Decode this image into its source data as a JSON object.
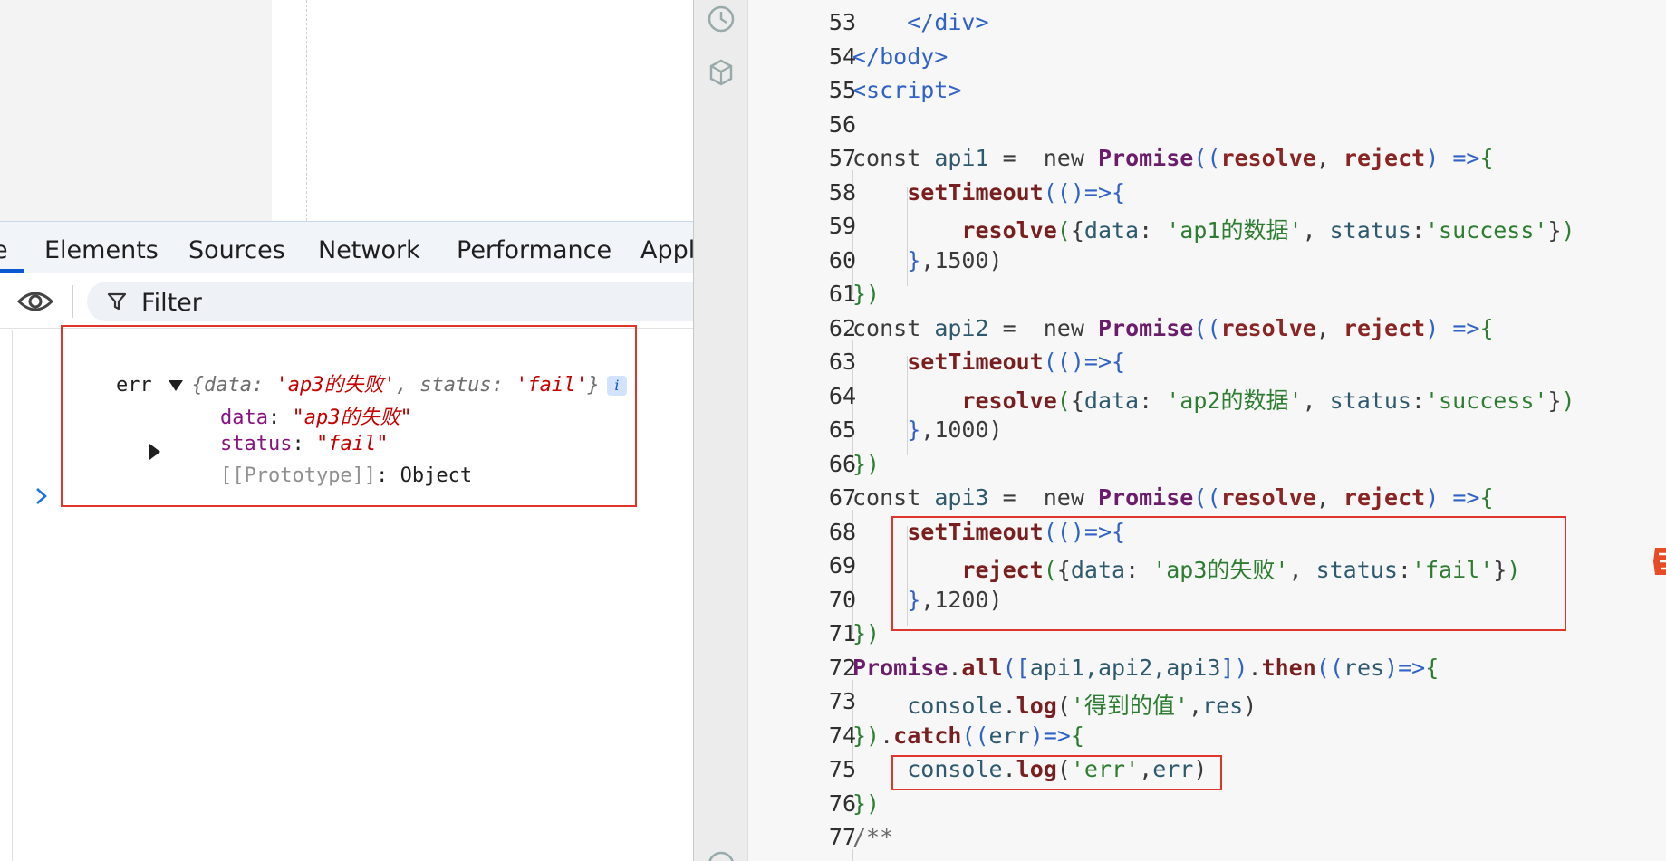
{
  "devtools": {
    "tabs": [
      {
        "label": "e",
        "active": true
      },
      {
        "label": "Elements",
        "active": false
      },
      {
        "label": "Sources",
        "active": false
      },
      {
        "label": "Network",
        "active": false
      },
      {
        "label": "Performance",
        "active": false
      },
      {
        "label": "Appl",
        "active": false
      }
    ],
    "filter_placeholder": "Filter",
    "accent_color": "#0b57d0"
  },
  "console": {
    "entry": {
      "label": "err",
      "summary": {
        "open": "{",
        "k1": "data",
        "v1": "'ap3的失败'",
        "sep": ", ",
        "k2": "status",
        "v2": "'fail'",
        "close": "}"
      },
      "info_badge": "i",
      "props": [
        {
          "key": "data",
          "value": "\"ap3的失败\""
        },
        {
          "key": "status",
          "value": "\"fail\""
        }
      ],
      "prototype": {
        "key": "[[Prototype]]",
        "value": "Object"
      }
    },
    "highlight_color": "#e0352b"
  },
  "editor": {
    "lines": [
      {
        "n": "53",
        "tokens": [
          [
            "    ",
            "k-plain"
          ],
          [
            "</div>",
            "k-tag"
          ]
        ]
      },
      {
        "n": "54",
        "tokens": [
          [
            "</body>",
            "k-tag"
          ]
        ]
      },
      {
        "n": "55",
        "tokens": [
          [
            "<script>",
            "k-tag"
          ]
        ]
      },
      {
        "n": "56",
        "tokens": []
      },
      {
        "n": "57",
        "tokens": [
          [
            "const ",
            "k-kw"
          ],
          [
            "api1",
            "k-var"
          ],
          [
            " =  ",
            "k-plain"
          ],
          [
            "new ",
            "k-kw"
          ],
          [
            "Promise",
            "k-cls"
          ],
          [
            "((",
            "k-brace2"
          ],
          [
            "resolve",
            "k-param"
          ],
          [
            ", ",
            "k-plain"
          ],
          [
            "reject",
            "k-param"
          ],
          [
            ") =>",
            "k-brace2"
          ],
          [
            "{",
            "k-brace"
          ]
        ]
      },
      {
        "n": "58",
        "tokens": [
          [
            "    ",
            "k-plain"
          ],
          [
            "setTimeout",
            "k-fn"
          ],
          [
            "(()=>",
            "k-brace2"
          ],
          [
            "{",
            "k-brace2"
          ]
        ]
      },
      {
        "n": "59",
        "tokens": [
          [
            "        ",
            "k-plain"
          ],
          [
            "resolve",
            "k-fn"
          ],
          [
            "(",
            "k-brace"
          ],
          [
            "{",
            "k-plain"
          ],
          [
            "data",
            "k-prop"
          ],
          [
            ": ",
            "k-plain"
          ],
          [
            "'ap1的数据'",
            "k-str"
          ],
          [
            ", ",
            "k-plain"
          ],
          [
            "status",
            "k-prop"
          ],
          [
            ":",
            "k-plain"
          ],
          [
            "'success'",
            "k-str"
          ],
          [
            "}",
            "k-plain"
          ],
          [
            ")",
            "k-brace"
          ]
        ]
      },
      {
        "n": "60",
        "tokens": [
          [
            "    ",
            "k-plain"
          ],
          [
            "}",
            "k-brace2"
          ],
          [
            ",1500",
            "k-num"
          ],
          [
            ")",
            "k-plain"
          ]
        ]
      },
      {
        "n": "61",
        "tokens": [
          [
            "})",
            "k-brace"
          ]
        ]
      },
      {
        "n": "62",
        "tokens": [
          [
            "const ",
            "k-kw"
          ],
          [
            "api2",
            "k-var"
          ],
          [
            " =  ",
            "k-plain"
          ],
          [
            "new ",
            "k-kw"
          ],
          [
            "Promise",
            "k-cls"
          ],
          [
            "((",
            "k-brace2"
          ],
          [
            "resolve",
            "k-param"
          ],
          [
            ", ",
            "k-plain"
          ],
          [
            "reject",
            "k-param"
          ],
          [
            ") =>",
            "k-brace2"
          ],
          [
            "{",
            "k-brace"
          ]
        ]
      },
      {
        "n": "63",
        "tokens": [
          [
            "    ",
            "k-plain"
          ],
          [
            "setTimeout",
            "k-fn"
          ],
          [
            "(()=>",
            "k-brace2"
          ],
          [
            "{",
            "k-brace2"
          ]
        ]
      },
      {
        "n": "64",
        "tokens": [
          [
            "        ",
            "k-plain"
          ],
          [
            "resolve",
            "k-fn"
          ],
          [
            "(",
            "k-brace"
          ],
          [
            "{",
            "k-plain"
          ],
          [
            "data",
            "k-prop"
          ],
          [
            ": ",
            "k-plain"
          ],
          [
            "'ap2的数据'",
            "k-str"
          ],
          [
            ", ",
            "k-plain"
          ],
          [
            "status",
            "k-prop"
          ],
          [
            ":",
            "k-plain"
          ],
          [
            "'success'",
            "k-str"
          ],
          [
            "}",
            "k-plain"
          ],
          [
            ")",
            "k-brace"
          ]
        ]
      },
      {
        "n": "65",
        "tokens": [
          [
            "    ",
            "k-plain"
          ],
          [
            "}",
            "k-brace2"
          ],
          [
            ",1000",
            "k-num"
          ],
          [
            ")",
            "k-plain"
          ]
        ]
      },
      {
        "n": "66",
        "tokens": [
          [
            "})",
            "k-brace"
          ]
        ]
      },
      {
        "n": "67",
        "tokens": [
          [
            "const ",
            "k-kw"
          ],
          [
            "api3",
            "k-var"
          ],
          [
            " =  ",
            "k-plain"
          ],
          [
            "new ",
            "k-kw"
          ],
          [
            "Promise",
            "k-cls"
          ],
          [
            "((",
            "k-brace2"
          ],
          [
            "resolve",
            "k-param"
          ],
          [
            ", ",
            "k-plain"
          ],
          [
            "reject",
            "k-param"
          ],
          [
            ") =>",
            "k-brace2"
          ],
          [
            "{",
            "k-brace"
          ]
        ]
      },
      {
        "n": "68",
        "tokens": [
          [
            "    ",
            "k-plain"
          ],
          [
            "setTimeout",
            "k-fn"
          ],
          [
            "(()=>",
            "k-brace2"
          ],
          [
            "{",
            "k-brace2"
          ]
        ]
      },
      {
        "n": "69",
        "tokens": [
          [
            "        ",
            "k-plain"
          ],
          [
            "reject",
            "k-fn"
          ],
          [
            "(",
            "k-brace"
          ],
          [
            "{",
            "k-plain"
          ],
          [
            "data",
            "k-prop"
          ],
          [
            ": ",
            "k-plain"
          ],
          [
            "'ap3的失败'",
            "k-str"
          ],
          [
            ", ",
            "k-plain"
          ],
          [
            "status",
            "k-prop"
          ],
          [
            ":",
            "k-plain"
          ],
          [
            "'fail'",
            "k-str"
          ],
          [
            "}",
            "k-plain"
          ],
          [
            ")",
            "k-brace"
          ]
        ]
      },
      {
        "n": "70",
        "tokens": [
          [
            "    ",
            "k-plain"
          ],
          [
            "}",
            "k-brace2"
          ],
          [
            ",1200",
            "k-num"
          ],
          [
            ")",
            "k-plain"
          ]
        ]
      },
      {
        "n": "71",
        "tokens": [
          [
            "})",
            "k-brace"
          ]
        ]
      },
      {
        "n": "72",
        "tokens": [
          [
            "Promise",
            "k-cls"
          ],
          [
            ".",
            "k-plain"
          ],
          [
            "all",
            "k-fn"
          ],
          [
            "([",
            "k-brace2"
          ],
          [
            "api1,api2,api3",
            "k-var"
          ],
          [
            "])",
            "k-brace2"
          ],
          [
            ".",
            "k-plain"
          ],
          [
            "then",
            "k-fn"
          ],
          [
            "((",
            "k-brace2"
          ],
          [
            "res",
            "k-var"
          ],
          [
            ")=>",
            "k-brace2"
          ],
          [
            "{",
            "k-brace"
          ]
        ]
      },
      {
        "n": "73",
        "tokens": [
          [
            "    ",
            "k-plain"
          ],
          [
            "console",
            "k-var"
          ],
          [
            ".",
            "k-plain"
          ],
          [
            "log",
            "k-fn"
          ],
          [
            "(",
            "k-plain"
          ],
          [
            "'得到的值'",
            "k-str"
          ],
          [
            ",",
            "k-plain"
          ],
          [
            "res",
            "k-var"
          ],
          [
            ")",
            "k-plain"
          ]
        ]
      },
      {
        "n": "74",
        "tokens": [
          [
            "})",
            "k-brace"
          ],
          [
            ".",
            "k-plain"
          ],
          [
            "catch",
            "k-fn"
          ],
          [
            "((",
            "k-brace2"
          ],
          [
            "err",
            "k-var"
          ],
          [
            ")=>",
            "k-brace2"
          ],
          [
            "{",
            "k-brace"
          ]
        ]
      },
      {
        "n": "75",
        "tokens": [
          [
            "    ",
            "k-plain"
          ],
          [
            "console",
            "k-var"
          ],
          [
            ".",
            "k-plain"
          ],
          [
            "log",
            "k-fn"
          ],
          [
            "(",
            "k-plain"
          ],
          [
            "'err'",
            "k-str"
          ],
          [
            ",",
            "k-plain"
          ],
          [
            "err",
            "k-var"
          ],
          [
            ")",
            "k-plain"
          ]
        ]
      },
      {
        "n": "76",
        "tokens": [
          [
            "})",
            "k-brace"
          ]
        ]
      },
      {
        "n": "77",
        "tokens": [
          [
            "/**",
            "k-cmt"
          ]
        ]
      }
    ]
  }
}
